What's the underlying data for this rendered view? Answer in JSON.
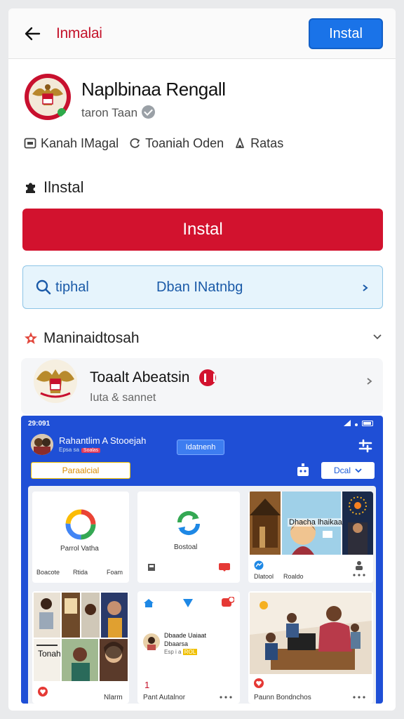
{
  "header": {
    "brand": "Inmalai",
    "install_label": "Instal"
  },
  "app": {
    "name": "Naplbinaa Rengall",
    "developer": "taron Taan"
  },
  "meta": [
    {
      "icon": "box-icon",
      "label": "Kanah IMagal"
    },
    {
      "icon": "refresh-icon",
      "label": "Toaniah  Oden"
    },
    {
      "icon": "person-icon",
      "label": "Ratas"
    }
  ],
  "section_install": {
    "title": "Ilnstal"
  },
  "primary_install": {
    "label": "Instal"
  },
  "search": {
    "label": "tiphal",
    "value": "Dban INatnbg"
  },
  "section_more": {
    "title": "Maninaidtosah"
  },
  "related": {
    "title": "Toaalt Abeatsin",
    "subtitle": "Iuta & sannet"
  },
  "screenshot": {
    "status_time": "29:091",
    "title": "Rahantlim A Stooejah",
    "subtitle": "Epsa sa",
    "subtitle_badge": "Soalas",
    "pill": "Idatnenh",
    "tab": "Paraalcial",
    "dropdown": "Dcal",
    "tile1": {
      "caption": "Parrol Vatha",
      "footer": [
        "Boacote",
        "Rtida",
        "Foam"
      ]
    },
    "tile2": {
      "caption": "Bostoal"
    },
    "tile3": {
      "caption": "Dhacha lhaikaat",
      "footer": [
        "Dlatool",
        "Roaldo"
      ]
    },
    "tile5": {
      "name": "Dbaade Uaiaat",
      "line2": "Dbaarsa",
      "line3": "Esp i a",
      "badge": "ROL",
      "number": "1",
      "footer": "Pant Autalnor"
    },
    "tile6": {
      "footer": "Paunn Bondnchos"
    },
    "tile4": {
      "label": "Tonah",
      "footer": "Nlarm"
    }
  },
  "colors": {
    "accent_blue": "#1a73e8",
    "accent_red": "#d2122e",
    "screenshot_blue": "#1f4fd6"
  }
}
